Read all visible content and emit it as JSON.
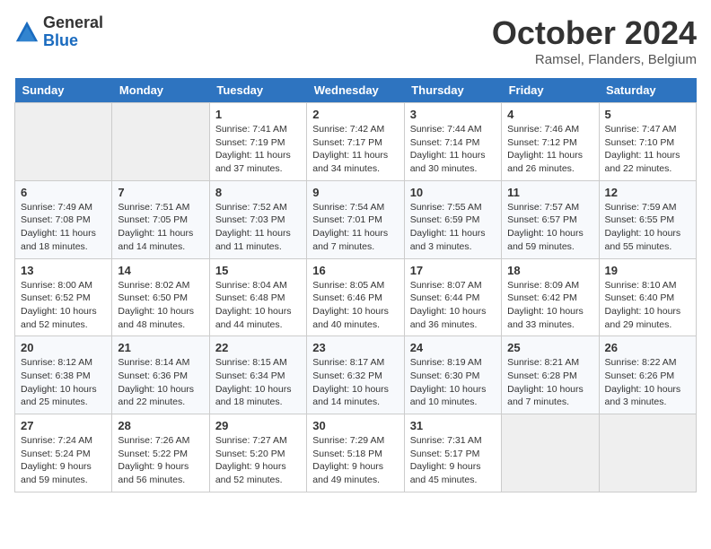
{
  "logo": {
    "general": "General",
    "blue": "Blue"
  },
  "title": "October 2024",
  "subtitle": "Ramsel, Flanders, Belgium",
  "days_of_week": [
    "Sunday",
    "Monday",
    "Tuesday",
    "Wednesday",
    "Thursday",
    "Friday",
    "Saturday"
  ],
  "weeks": [
    [
      {
        "day": null,
        "sunrise": null,
        "sunset": null,
        "daylight": null
      },
      {
        "day": null,
        "sunrise": null,
        "sunset": null,
        "daylight": null
      },
      {
        "day": "1",
        "sunrise": "Sunrise: 7:41 AM",
        "sunset": "Sunset: 7:19 PM",
        "daylight": "Daylight: 11 hours and 37 minutes."
      },
      {
        "day": "2",
        "sunrise": "Sunrise: 7:42 AM",
        "sunset": "Sunset: 7:17 PM",
        "daylight": "Daylight: 11 hours and 34 minutes."
      },
      {
        "day": "3",
        "sunrise": "Sunrise: 7:44 AM",
        "sunset": "Sunset: 7:14 PM",
        "daylight": "Daylight: 11 hours and 30 minutes."
      },
      {
        "day": "4",
        "sunrise": "Sunrise: 7:46 AM",
        "sunset": "Sunset: 7:12 PM",
        "daylight": "Daylight: 11 hours and 26 minutes."
      },
      {
        "day": "5",
        "sunrise": "Sunrise: 7:47 AM",
        "sunset": "Sunset: 7:10 PM",
        "daylight": "Daylight: 11 hours and 22 minutes."
      }
    ],
    [
      {
        "day": "6",
        "sunrise": "Sunrise: 7:49 AM",
        "sunset": "Sunset: 7:08 PM",
        "daylight": "Daylight: 11 hours and 18 minutes."
      },
      {
        "day": "7",
        "sunrise": "Sunrise: 7:51 AM",
        "sunset": "Sunset: 7:05 PM",
        "daylight": "Daylight: 11 hours and 14 minutes."
      },
      {
        "day": "8",
        "sunrise": "Sunrise: 7:52 AM",
        "sunset": "Sunset: 7:03 PM",
        "daylight": "Daylight: 11 hours and 11 minutes."
      },
      {
        "day": "9",
        "sunrise": "Sunrise: 7:54 AM",
        "sunset": "Sunset: 7:01 PM",
        "daylight": "Daylight: 11 hours and 7 minutes."
      },
      {
        "day": "10",
        "sunrise": "Sunrise: 7:55 AM",
        "sunset": "Sunset: 6:59 PM",
        "daylight": "Daylight: 11 hours and 3 minutes."
      },
      {
        "day": "11",
        "sunrise": "Sunrise: 7:57 AM",
        "sunset": "Sunset: 6:57 PM",
        "daylight": "Daylight: 10 hours and 59 minutes."
      },
      {
        "day": "12",
        "sunrise": "Sunrise: 7:59 AM",
        "sunset": "Sunset: 6:55 PM",
        "daylight": "Daylight: 10 hours and 55 minutes."
      }
    ],
    [
      {
        "day": "13",
        "sunrise": "Sunrise: 8:00 AM",
        "sunset": "Sunset: 6:52 PM",
        "daylight": "Daylight: 10 hours and 52 minutes."
      },
      {
        "day": "14",
        "sunrise": "Sunrise: 8:02 AM",
        "sunset": "Sunset: 6:50 PM",
        "daylight": "Daylight: 10 hours and 48 minutes."
      },
      {
        "day": "15",
        "sunrise": "Sunrise: 8:04 AM",
        "sunset": "Sunset: 6:48 PM",
        "daylight": "Daylight: 10 hours and 44 minutes."
      },
      {
        "day": "16",
        "sunrise": "Sunrise: 8:05 AM",
        "sunset": "Sunset: 6:46 PM",
        "daylight": "Daylight: 10 hours and 40 minutes."
      },
      {
        "day": "17",
        "sunrise": "Sunrise: 8:07 AM",
        "sunset": "Sunset: 6:44 PM",
        "daylight": "Daylight: 10 hours and 36 minutes."
      },
      {
        "day": "18",
        "sunrise": "Sunrise: 8:09 AM",
        "sunset": "Sunset: 6:42 PM",
        "daylight": "Daylight: 10 hours and 33 minutes."
      },
      {
        "day": "19",
        "sunrise": "Sunrise: 8:10 AM",
        "sunset": "Sunset: 6:40 PM",
        "daylight": "Daylight: 10 hours and 29 minutes."
      }
    ],
    [
      {
        "day": "20",
        "sunrise": "Sunrise: 8:12 AM",
        "sunset": "Sunset: 6:38 PM",
        "daylight": "Daylight: 10 hours and 25 minutes."
      },
      {
        "day": "21",
        "sunrise": "Sunrise: 8:14 AM",
        "sunset": "Sunset: 6:36 PM",
        "daylight": "Daylight: 10 hours and 22 minutes."
      },
      {
        "day": "22",
        "sunrise": "Sunrise: 8:15 AM",
        "sunset": "Sunset: 6:34 PM",
        "daylight": "Daylight: 10 hours and 18 minutes."
      },
      {
        "day": "23",
        "sunrise": "Sunrise: 8:17 AM",
        "sunset": "Sunset: 6:32 PM",
        "daylight": "Daylight: 10 hours and 14 minutes."
      },
      {
        "day": "24",
        "sunrise": "Sunrise: 8:19 AM",
        "sunset": "Sunset: 6:30 PM",
        "daylight": "Daylight: 10 hours and 10 minutes."
      },
      {
        "day": "25",
        "sunrise": "Sunrise: 8:21 AM",
        "sunset": "Sunset: 6:28 PM",
        "daylight": "Daylight: 10 hours and 7 minutes."
      },
      {
        "day": "26",
        "sunrise": "Sunrise: 8:22 AM",
        "sunset": "Sunset: 6:26 PM",
        "daylight": "Daylight: 10 hours and 3 minutes."
      }
    ],
    [
      {
        "day": "27",
        "sunrise": "Sunrise: 7:24 AM",
        "sunset": "Sunset: 5:24 PM",
        "daylight": "Daylight: 9 hours and 59 minutes."
      },
      {
        "day": "28",
        "sunrise": "Sunrise: 7:26 AM",
        "sunset": "Sunset: 5:22 PM",
        "daylight": "Daylight: 9 hours and 56 minutes."
      },
      {
        "day": "29",
        "sunrise": "Sunrise: 7:27 AM",
        "sunset": "Sunset: 5:20 PM",
        "daylight": "Daylight: 9 hours and 52 minutes."
      },
      {
        "day": "30",
        "sunrise": "Sunrise: 7:29 AM",
        "sunset": "Sunset: 5:18 PM",
        "daylight": "Daylight: 9 hours and 49 minutes."
      },
      {
        "day": "31",
        "sunrise": "Sunrise: 7:31 AM",
        "sunset": "Sunset: 5:17 PM",
        "daylight": "Daylight: 9 hours and 45 minutes."
      },
      {
        "day": null,
        "sunrise": null,
        "sunset": null,
        "daylight": null
      },
      {
        "day": null,
        "sunrise": null,
        "sunset": null,
        "daylight": null
      }
    ]
  ]
}
